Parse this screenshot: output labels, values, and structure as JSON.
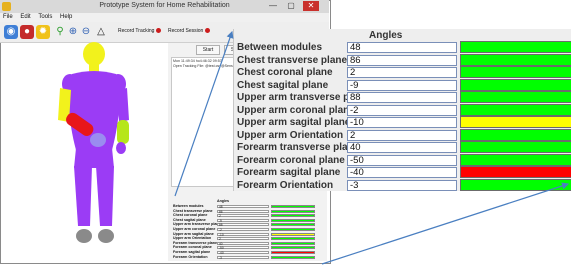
{
  "window": {
    "title": "Prototype System for Home Rehabilitation",
    "min_glyph": "—",
    "max_glyph": "▢",
    "close_glyph": "✕"
  },
  "menu": [
    "File",
    "Edit",
    "Tools",
    "Help"
  ],
  "toolbar": {
    "record_tracking_label": "Record Tracking",
    "record_session_label": "Record Session"
  },
  "right_panel": {
    "start_label": "Start",
    "stop_label": "Stop",
    "log_lines": [
      "Mon 11:49:34 ho4:46:32 09:57",
      "Open Tracking File: @test.csv@Sensors..."
    ]
  },
  "angles": {
    "header": "Angles",
    "rows": [
      {
        "label": "Between modules",
        "value": "48",
        "status": "green"
      },
      {
        "label": "Chest transverse plane",
        "value": "86",
        "status": "green"
      },
      {
        "label": "Chest coronal plane",
        "value": "2",
        "status": "green"
      },
      {
        "label": "Chest sagital plane",
        "value": "-9",
        "status": "green"
      },
      {
        "label": "Upper arm transverse plane",
        "value": "88",
        "status": "green"
      },
      {
        "label": "Upper arm coronal plane",
        "value": "-2",
        "status": "green"
      },
      {
        "label": "Upper arm sagital plane",
        "value": "-10",
        "status": "yellow"
      },
      {
        "label": "Upper arm Orientation",
        "value": "2",
        "status": "green"
      },
      {
        "label": "Forearm transverse plane",
        "value": "40",
        "status": "green"
      },
      {
        "label": "Forearm coronal plane",
        "value": "-50",
        "status": "green"
      },
      {
        "label": "Forearm sagital plane",
        "value": "-40",
        "status": "red"
      },
      {
        "label": "Forearm Orientation",
        "value": "-3",
        "status": "green"
      }
    ]
  },
  "colors": {
    "green": "#00ff00",
    "yellow": "#ffff00",
    "red": "#ff0000",
    "arrow": "#4a7fc1",
    "body_purple": "#9b3cf5",
    "head_yellow": "#f2f21c",
    "arm_red": "#e8161a",
    "arm_green": "#b6e61a",
    "hand_blue": "#9a8cf0",
    "feet_gray": "#8a8a8a"
  },
  "icons": [
    "app-icon",
    "open-icon",
    "save-icon",
    "settings-icon",
    "search-icon",
    "zoom-in-icon",
    "zoom-out-icon",
    "triangle-icon"
  ]
}
